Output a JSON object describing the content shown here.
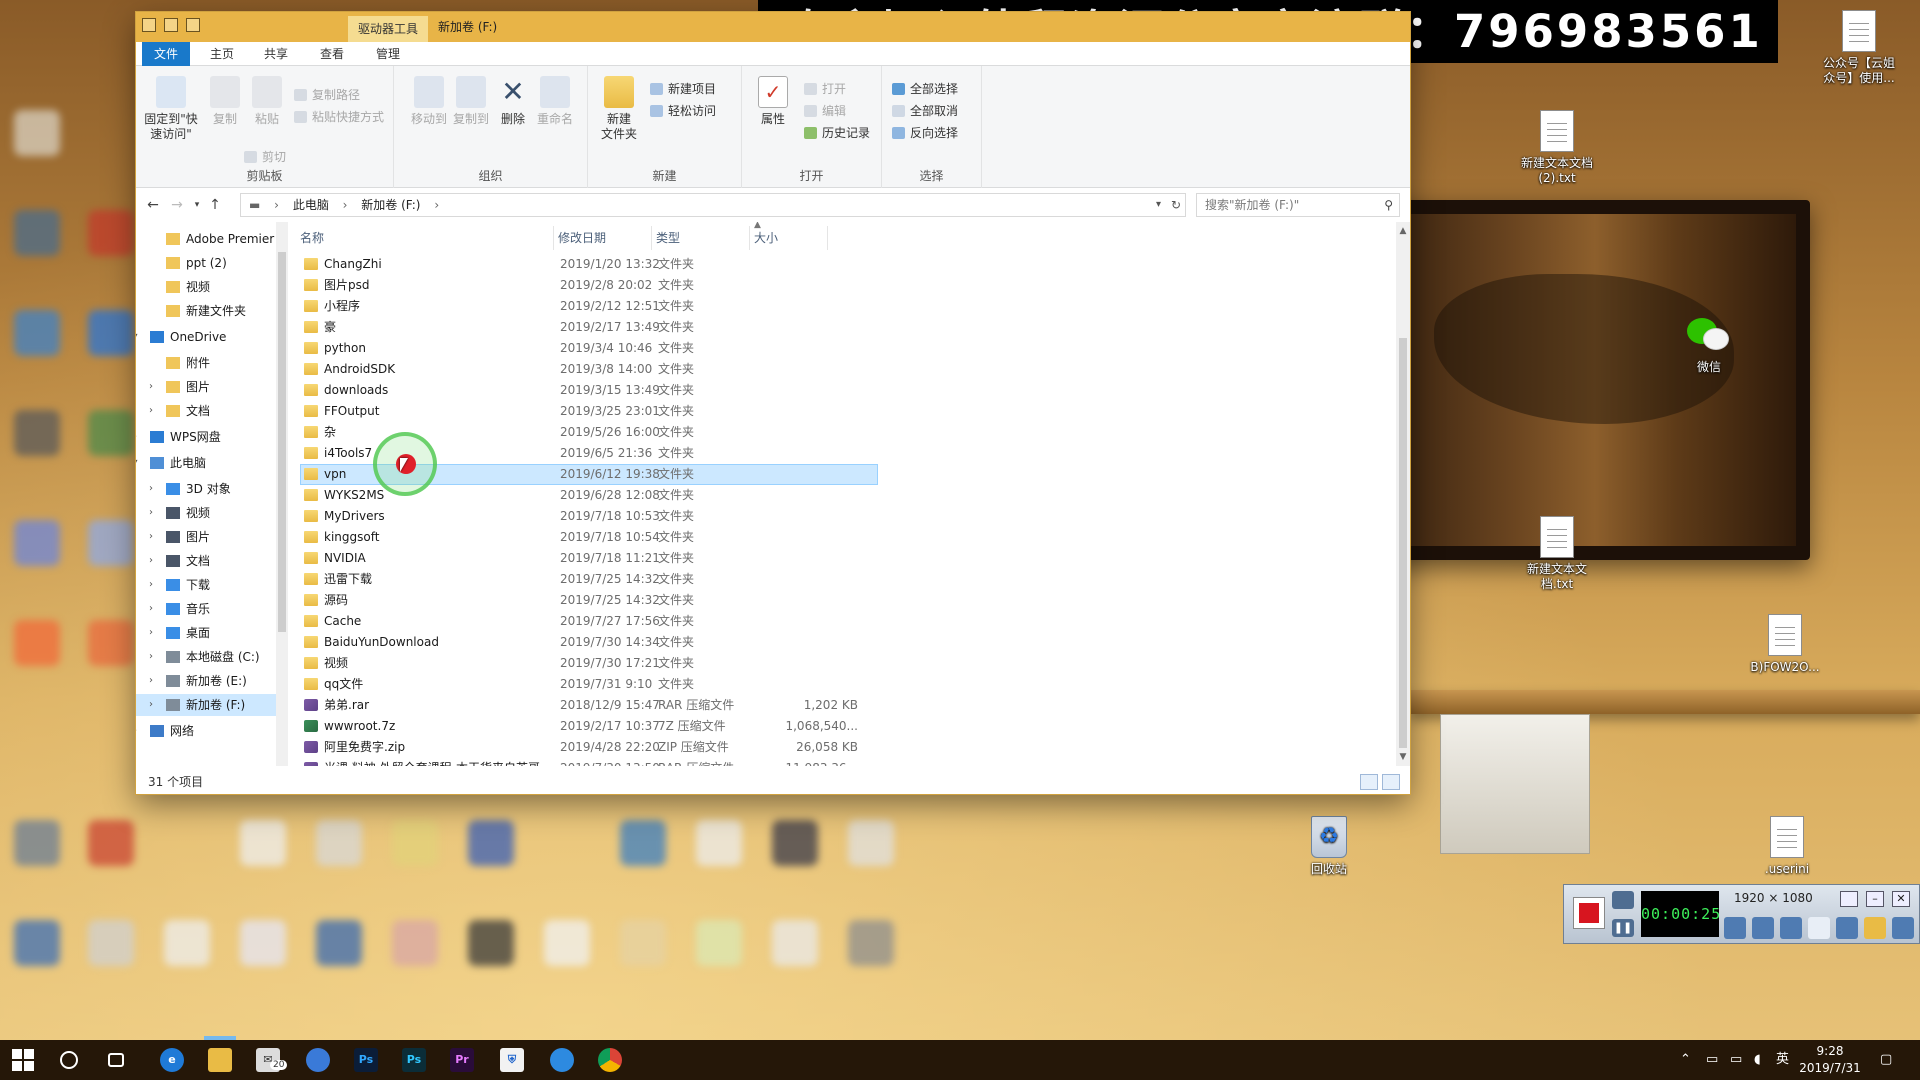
{
  "banner": {
    "text": "欢迎加入外贸资源分享交流群：796983561"
  },
  "window": {
    "tools_tab": "驱动器工具",
    "title": "新加卷 (F:)",
    "tabs": [
      "文件",
      "主页",
      "共享",
      "查看",
      "管理"
    ]
  },
  "ribbon": {
    "clipboard": {
      "label": "剪贴板",
      "pin": "固定到\"快\n速访问\"",
      "copy": "复制",
      "paste": "粘贴",
      "copy_path": "复制路径",
      "paste_shortcut": "粘贴快捷方式",
      "cut": "剪切"
    },
    "organize": {
      "label": "组织",
      "move_to": "移动到",
      "copy_to": "复制到",
      "delete": "删除",
      "rename": "重命名"
    },
    "new": {
      "label": "新建",
      "new_folder": "新建\n文件夹",
      "new_item": "新建项目",
      "easy_access": "轻松访问"
    },
    "open": {
      "label": "打开",
      "properties": "属性",
      "open": "打开",
      "edit": "编辑",
      "history": "历史记录"
    },
    "select": {
      "label": "选择",
      "select_all": "全部选择",
      "select_none": "全部取消",
      "invert": "反向选择"
    }
  },
  "address": {
    "crumbs": [
      "此电脑",
      "新加卷 (F:)"
    ],
    "search_placeholder": "搜索\"新加卷 (F:)\""
  },
  "nav": [
    {
      "label": "Adobe Premier",
      "kind": "folder",
      "indent": 1,
      "chev": ""
    },
    {
      "label": "ppt (2)",
      "kind": "folder",
      "indent": 1,
      "chev": ""
    },
    {
      "label": "视频",
      "kind": "folder",
      "indent": 1,
      "chev": ""
    },
    {
      "label": "新建文件夹",
      "kind": "folder",
      "indent": 1,
      "chev": ""
    },
    {
      "label": "OneDrive",
      "kind": "cloud",
      "indent": 0,
      "chev": "▾"
    },
    {
      "label": "附件",
      "kind": "folder",
      "indent": 1,
      "chev": ""
    },
    {
      "label": "图片",
      "kind": "folder",
      "indent": 1,
      "chev": "›"
    },
    {
      "label": "文档",
      "kind": "folder",
      "indent": 1,
      "chev": "›"
    },
    {
      "label": "WPS网盘",
      "kind": "cloud",
      "indent": 0,
      "chev": "›"
    },
    {
      "label": "此电脑",
      "kind": "pc",
      "indent": 0,
      "chev": "▾"
    },
    {
      "label": "3D 对象",
      "kind": "blue",
      "indent": 1,
      "chev": "›"
    },
    {
      "label": "视频",
      "kind": "dark",
      "indent": 1,
      "chev": "›"
    },
    {
      "label": "图片",
      "kind": "dark",
      "indent": 1,
      "chev": "›"
    },
    {
      "label": "文档",
      "kind": "dark",
      "indent": 1,
      "chev": "›"
    },
    {
      "label": "下载",
      "kind": "blue",
      "indent": 1,
      "chev": "›"
    },
    {
      "label": "音乐",
      "kind": "blue",
      "indent": 1,
      "chev": "›"
    },
    {
      "label": "桌面",
      "kind": "blue",
      "indent": 1,
      "chev": "›"
    },
    {
      "label": "本地磁盘 (C:)",
      "kind": "drive",
      "indent": 1,
      "chev": "›"
    },
    {
      "label": "新加卷 (E:)",
      "kind": "drive",
      "indent": 1,
      "chev": "›"
    },
    {
      "label": "新加卷 (F:)",
      "kind": "drive",
      "indent": 1,
      "chev": "›",
      "selected": true
    },
    {
      "label": "网络",
      "kind": "net",
      "indent": 0,
      "chev": "›"
    }
  ],
  "columns": {
    "name": "名称",
    "date": "修改日期",
    "type": "类型",
    "size": "大小"
  },
  "files": [
    {
      "name": "ChangZhi",
      "date": "2019/1/20 13:32",
      "type": "文件夹",
      "size": "",
      "icon": "folder"
    },
    {
      "name": "图片psd",
      "date": "2019/2/8 20:02",
      "type": "文件夹",
      "size": "",
      "icon": "folder"
    },
    {
      "name": "小程序",
      "date": "2019/2/12 12:51",
      "type": "文件夹",
      "size": "",
      "icon": "folder"
    },
    {
      "name": "豪",
      "date": "2019/2/17 13:49",
      "type": "文件夹",
      "size": "",
      "icon": "folder"
    },
    {
      "name": "python",
      "date": "2019/3/4 10:46",
      "type": "文件夹",
      "size": "",
      "icon": "folder"
    },
    {
      "name": "AndroidSDK",
      "date": "2019/3/8 14:00",
      "type": "文件夹",
      "size": "",
      "icon": "folder"
    },
    {
      "name": "downloads",
      "date": "2019/3/15 13:49",
      "type": "文件夹",
      "size": "",
      "icon": "folder"
    },
    {
      "name": "FFOutput",
      "date": "2019/3/25 23:01",
      "type": "文件夹",
      "size": "",
      "icon": "folder"
    },
    {
      "name": "杂",
      "date": "2019/5/26 16:00",
      "type": "文件夹",
      "size": "",
      "icon": "folder"
    },
    {
      "name": "i4Tools7",
      "date": "2019/6/5 21:36",
      "type": "文件夹",
      "size": "",
      "icon": "folder"
    },
    {
      "name": "vpn",
      "date": "2019/6/12 19:38",
      "type": "文件夹",
      "size": "",
      "icon": "folder",
      "selected": true
    },
    {
      "name": "WYKS2MS",
      "date": "2019/6/28 12:08",
      "type": "文件夹",
      "size": "",
      "icon": "folder"
    },
    {
      "name": "MyDrivers",
      "date": "2019/7/18 10:53",
      "type": "文件夹",
      "size": "",
      "icon": "folder"
    },
    {
      "name": "kinggsoft",
      "date": "2019/7/18 10:54",
      "type": "文件夹",
      "size": "",
      "icon": "folder"
    },
    {
      "name": "NVIDIA",
      "date": "2019/7/18 11:21",
      "type": "文件夹",
      "size": "",
      "icon": "folder"
    },
    {
      "name": "迅雷下载",
      "date": "2019/7/25 14:32",
      "type": "文件夹",
      "size": "",
      "icon": "folder"
    },
    {
      "name": "源码",
      "date": "2019/7/25 14:32",
      "type": "文件夹",
      "size": "",
      "icon": "folder"
    },
    {
      "name": "Cache",
      "date": "2019/7/27 17:56",
      "type": "文件夹",
      "size": "",
      "icon": "folder"
    },
    {
      "name": "BaiduYunDownload",
      "date": "2019/7/30 14:34",
      "type": "文件夹",
      "size": "",
      "icon": "folder"
    },
    {
      "name": "视频",
      "date": "2019/7/30 17:21",
      "type": "文件夹",
      "size": "",
      "icon": "folder"
    },
    {
      "name": "qq文件",
      "date": "2019/7/31 9:10",
      "type": "文件夹",
      "size": "",
      "icon": "folder"
    },
    {
      "name": "弟弟.rar",
      "date": "2018/12/9 15:47",
      "type": "RAR 压缩文件",
      "size": "1,202 KB",
      "icon": "archive"
    },
    {
      "name": "wwwroot.7z",
      "date": "2019/2/17 10:37",
      "type": "7Z 压缩文件",
      "size": "1,068,540...",
      "icon": "zip7"
    },
    {
      "name": "阿里免费字.zip",
      "date": "2019/4/28 22:20",
      "type": "ZIP 压缩文件",
      "size": "26,058 KB",
      "icon": "archive"
    },
    {
      "name": "米课 料神 外贸全套课程-本干货来自芙哥...",
      "date": "2019/7/30 13:50",
      "type": "RAR 压缩文件",
      "size": "11,983,36...",
      "icon": "archive"
    }
  ],
  "status": {
    "count": "31 个项目"
  },
  "desktop_icons": [
    {
      "label": "公众号【云姐\n众号】使用...",
      "kind": "doc"
    },
    {
      "label": "新建文本文档\n(2).txt",
      "kind": "doc"
    },
    {
      "label": "微信",
      "kind": "wechat"
    },
    {
      "label": "新建文本文\n档.txt",
      "kind": "doc"
    },
    {
      "label": "B)FOW2O...",
      "kind": "doc"
    },
    {
      "label": "回收站",
      "kind": "recycle"
    },
    {
      "label": ".userini",
      "kind": "doc"
    }
  ],
  "recorder": {
    "timer": "00:00:25",
    "resolution": "1920 × 1080"
  },
  "taskbar": {
    "time": "9:28",
    "date": "2019/7/31",
    "ime": "英",
    "badge": "20"
  }
}
